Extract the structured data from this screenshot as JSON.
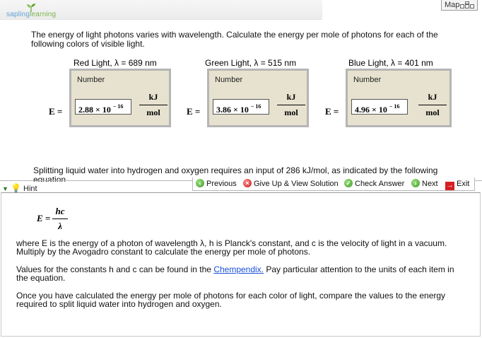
{
  "header": {
    "logo_text_a": "sapling",
    "logo_text_b": "learning",
    "map_label": "Map"
  },
  "problem": {
    "question": "The energy of light photons varies with wavelength. Calculate the energy per mole of photons for each of the following colors of visible light.",
    "e_label": "E =",
    "number_title": "Number",
    "unit_numerator": "kJ",
    "unit_denominator": "mol",
    "answers": [
      {
        "label": "Red Light, λ = 689 nm",
        "mantissa": "2.88",
        "times_ten": "× 10",
        "exponent": "− 16"
      },
      {
        "label": "Green Light, λ = 515 nm",
        "mantissa": "3.86",
        "times_ten": "× 10",
        "exponent": "− 16"
      },
      {
        "label": "Blue Light, λ = 401 nm",
        "mantissa": "4.96",
        "times_ten": "× 10",
        "exponent": "− 16"
      }
    ],
    "second_question": "Splitting liquid water into hydrogen and oxygen requires an input of 286 kJ/mol, as indicated by the following equation"
  },
  "toolbar": {
    "previous": "Previous",
    "give_up": "Give Up & View Solution",
    "check": "Check Answer",
    "next": "Next",
    "exit": "Exit"
  },
  "hint": {
    "tab_label": "Hint",
    "formula_lhs": "E =",
    "formula_num": "hc",
    "formula_den": "λ",
    "p1": "where E is the energy of a photon of wavelength λ, h is Planck's constant, and c is the velocity of light in a vacuum. Multiply by the Avogadro constant to calculate the energy per mole of photons.",
    "p2_before": "Values for the constants h and c can be found in the ",
    "p2_link": "Chempendix.",
    "p2_after": " Pay particular attention to the units of each item in the equation.",
    "p3": "Once you have calculated the energy per mole of photons for each color of light, compare the values to the energy required to split liquid water into hydrogen and oxygen."
  }
}
